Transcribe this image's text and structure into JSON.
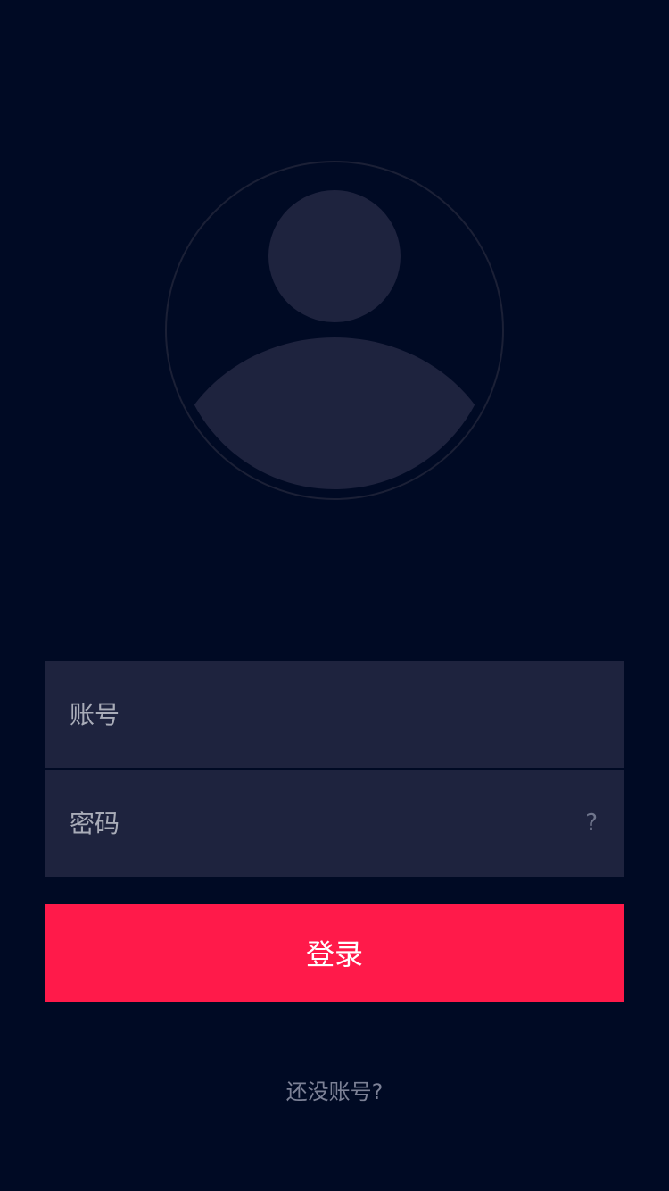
{
  "avatar": {
    "icon": "user-avatar-placeholder-icon",
    "ring_color": "#1b2036",
    "fill_color": "#1e233e"
  },
  "form": {
    "account": {
      "placeholder": "账号",
      "value": ""
    },
    "password": {
      "placeholder": "密码",
      "value": "",
      "help_icon": "?"
    }
  },
  "login_button": {
    "label": "登录",
    "color": "#ff1a4a"
  },
  "signup_link": {
    "label": "还没账号?"
  },
  "colors": {
    "background": "#000a24",
    "field_background": "#1e233e",
    "accent": "#ff1a4a"
  }
}
